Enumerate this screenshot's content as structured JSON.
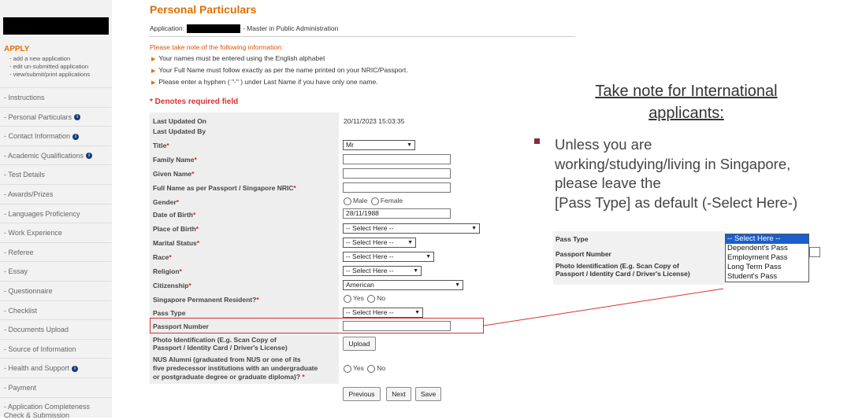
{
  "sidebar": {
    "apply_label": "APPLY",
    "apply_links": [
      "- add a new application",
      "- edit un-submitted application",
      "- view/submit/print applications"
    ],
    "items": [
      {
        "label": "- Instructions",
        "info": false
      },
      {
        "label": "- Personal Particulars",
        "info": true
      },
      {
        "label": "- Contact Information",
        "info": true
      },
      {
        "label": "- Academic Qualifications",
        "info": true
      },
      {
        "label": "- Test Details",
        "info": false
      },
      {
        "label": "- Awards/Prizes",
        "info": false
      },
      {
        "label": "- Languages Proficiency",
        "info": false
      },
      {
        "label": "- Work Experience",
        "info": false
      },
      {
        "label": "- Referee",
        "info": false
      },
      {
        "label": "- Essay",
        "info": false
      },
      {
        "label": "- Questionnaire",
        "info": false
      },
      {
        "label": "- Checklist",
        "info": false
      },
      {
        "label": "- Documents Upload",
        "info": false
      },
      {
        "label": "- Source of Information",
        "info": false
      },
      {
        "label": "- Health and Support",
        "info": true
      },
      {
        "label": "- Payment",
        "info": false
      },
      {
        "label": "- Application Completeness Check & Submission",
        "info": false
      }
    ]
  },
  "page": {
    "title": "Personal Particulars",
    "application_label": "Application:",
    "application_program": "- Master in Public Administration",
    "notes_heading": "Please take note of the following information:",
    "notes": [
      "Your names must be entered using the English alphabet",
      "Your Full Name must follow exactly as per the name printed on your NRIC/Passport.",
      "Please enter a hyphen ( \"-\" ) under Last Name if you have only one name."
    ],
    "required_note": "* Denotes required field"
  },
  "form": {
    "last_updated_on_label": "Last Updated On",
    "last_updated_on_value": "20/11/2023 15:03:35",
    "last_updated_by_label": "Last Updated By",
    "title_label": "Title",
    "title_value": "Mr",
    "family_name_label": "Family Name",
    "given_name_label": "Given Name",
    "full_name_label": "Full Name as per Passport / Singapore NRIC",
    "gender_label": "Gender",
    "gender_male": "Male",
    "gender_female": "Female",
    "dob_label": "Date of Birth",
    "dob_value": "28/11/1988",
    "place_of_birth_label": "Place of Birth",
    "place_of_birth_value": "-- Select Here --",
    "marital_label": "Marital Status",
    "marital_value": "-- Select Here --",
    "race_label": "Race",
    "race_value": "-- Select Here --",
    "religion_label": "Religion",
    "religion_value": "-- Select Here --",
    "citizenship_label": "Citizenship",
    "citizenship_value": "American",
    "spr_label": "Singapore Permanent Resident?",
    "yes": "Yes",
    "no": "No",
    "pass_type_label": "Pass Type",
    "pass_type_value": "-- Select Here --",
    "passport_label": "Passport Number",
    "photo_id_label_1": "Photo Identification (E.g. Scan Copy of",
    "photo_id_label_2": "Passport / Identity Card / Driver's License)",
    "upload_button": "Upload",
    "alumni_label_1": "NUS Alumni (graduated from NUS or one of its",
    "alumni_label_2": "five predecessor institutions with an undergraduate",
    "alumni_label_3": "or postgraduate degree or graduate diploma)?",
    "previous_button": "Previous",
    "next_button": "Next",
    "save_button": "Save"
  },
  "side_note": {
    "title_line1": "Take note for International",
    "title_line2": "applicants:",
    "body_line1": "Unless you are",
    "body_line2": "working/studying/living in Singapore,",
    "body_line3": "please leave the",
    "body_line4": "[Pass Type] as default (-Select Here-)"
  },
  "zoom_crop": {
    "pass_type_label": "Pass Type",
    "passport_label": "Passport Number",
    "photo_label_1": "Photo Identification (E.g. Scan Copy of",
    "photo_label_2": "Passport / Identity Card / Driver's License)",
    "options": [
      "-- Select Here --",
      "Dependent's Pass",
      "Employment Pass",
      "Long Term Pass",
      "Student's Pass"
    ]
  },
  "colors": {
    "accent": "#e07000",
    "required": "#e02020",
    "highlight_box": "#d93030",
    "dropdown_selected": "#1a5fcc"
  }
}
